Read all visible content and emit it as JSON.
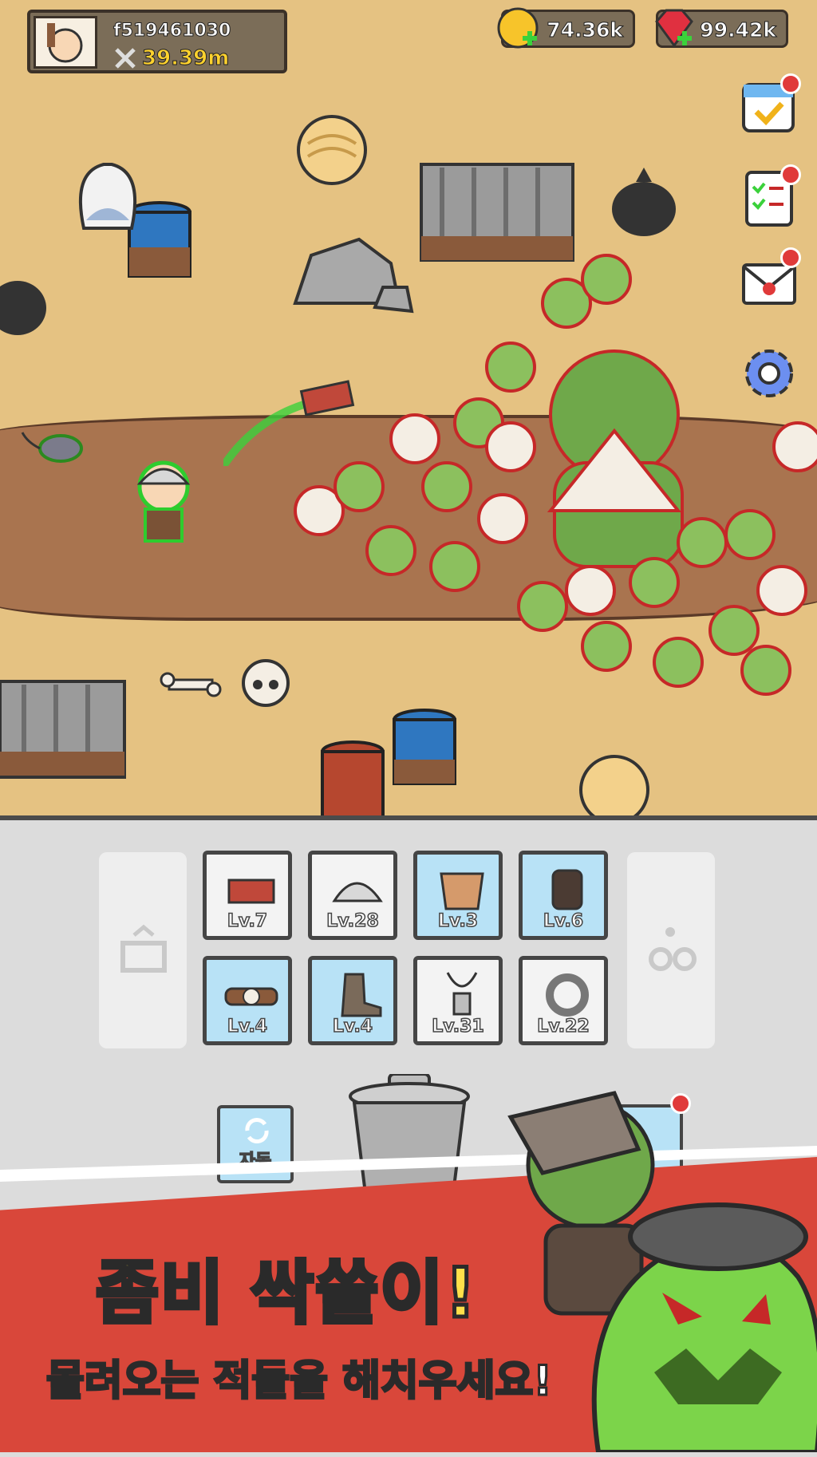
{
  "hud": {
    "user_id": "f519461030",
    "power": "39.39m",
    "coins": "74.36k",
    "gems": "99.42k"
  },
  "side_icons": [
    "calendar-icon",
    "checklist-icon",
    "mail-icon",
    "gear-icon"
  ],
  "equipment": [
    {
      "name": "brick",
      "level": "Lv.7",
      "highlight": false
    },
    {
      "name": "helmet",
      "level": "Lv.28",
      "highlight": false
    },
    {
      "name": "armor",
      "level": "Lv.3",
      "highlight": true
    },
    {
      "name": "glove",
      "level": "Lv.6",
      "highlight": true
    },
    {
      "name": "belt",
      "level": "Lv.4",
      "highlight": true
    },
    {
      "name": "boot",
      "level": "Lv.4",
      "highlight": true
    },
    {
      "name": "necklace",
      "level": "Lv.31",
      "highlight": false
    },
    {
      "name": "ring",
      "level": "Lv.22",
      "highlight": false
    }
  ],
  "auto_button": "자동",
  "promo": {
    "title": "좀비 싹쓸이!",
    "subtitle": "몰려오는 적들을 해치우세요!"
  },
  "colors": {
    "ground": "#e5c282",
    "road": "#a9744f",
    "banner": "#d9473a",
    "title": "#ffe04a",
    "slot_blue": "#b8e2f6"
  }
}
